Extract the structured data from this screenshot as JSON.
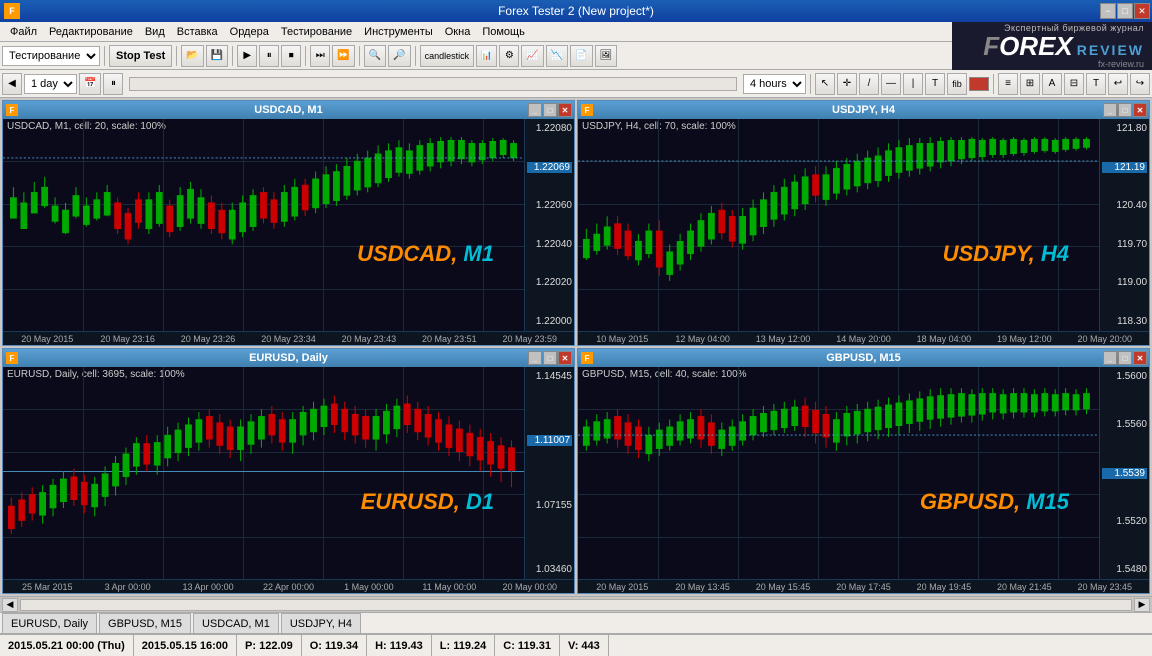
{
  "app": {
    "title": "Forex Tester 2  (New project*)",
    "icon": "FT"
  },
  "titlebar": {
    "minimize": "−",
    "maximize": "□",
    "close": "✕"
  },
  "menubar": {
    "items": [
      "Файл",
      "Редактирование",
      "Вид",
      "Вставка",
      "Ордера",
      "Тестирование",
      "Инструменты",
      "Окна",
      "Помощь"
    ]
  },
  "toolbar1": {
    "testing_label": "Тестирование",
    "stop_test": "Stop Test",
    "timeframe": "1 day"
  },
  "toolbar2": {
    "timeframe2": "4 hours"
  },
  "forex_review": {
    "tagline": "Экспертный биржевой журнал",
    "logo1": "FOREX",
    "logo2": "REVIEW",
    "url": "fx-review.ru"
  },
  "charts": [
    {
      "id": "usdcad",
      "title": "USDCAD, M1",
      "info": "USDCAD, M1, cell: 20, scale: 100%",
      "watermark_pair": "USDCAD,",
      "watermark_tf": " M1",
      "prices": [
        "1.22080",
        "1.22069",
        "1.22060",
        "1.22040",
        "1.22020",
        "1.22000"
      ],
      "highlight_price": "1.22069",
      "times": [
        "20 May 2015",
        "20 May 23:16",
        "20 May 23:26",
        "20 May 23:34",
        "20 May 23:43",
        "20 May 23:51",
        "20 May 23:59"
      ],
      "position": "top-left"
    },
    {
      "id": "usdjpy",
      "title": "USDJPY, H4",
      "info": "USDJPY, H4, cell: 70, scale: 100%",
      "watermark_pair": "USDJPY,",
      "watermark_tf": " H4",
      "prices": [
        "121.80",
        "121.19",
        "120.40",
        "119.70",
        "119.00",
        "118.30"
      ],
      "highlight_price": "121.19",
      "times": [
        "10 May 2015",
        "12 May 04:00",
        "13 May 12:00",
        "14 May 20:00",
        "18 May 04:00",
        "19 May 12:00",
        "20 May 20:00"
      ],
      "position": "top-right"
    },
    {
      "id": "eurusd",
      "title": "EURUSD, Daily",
      "info": "EURUSD, Daily, cell: 3695, scale: 100%",
      "watermark_pair": "EURUSD,",
      "watermark_tf": " D1",
      "prices": [
        "1.14545",
        "1.11007",
        "1.07155",
        "1.03460"
      ],
      "highlight_price": "1.11007",
      "times": [
        "25 Mar 2015",
        "3 Apr 00:00",
        "13 Apr 00:00",
        "22 Apr 00:00",
        "1 May 00:00",
        "11 May 00:00",
        "20 May 00:00"
      ],
      "position": "bottom-left"
    },
    {
      "id": "gbpusd",
      "title": "GBPUSD, M15",
      "info": "GBPUSD, M15, cell: 40, scale: 100%",
      "watermark_pair": "GBPUSD,",
      "watermark_tf": " M15",
      "prices": [
        "1.5600",
        "1.5560",
        "1.5539",
        "1.5520",
        "1.5480"
      ],
      "highlight_price": "1.5539",
      "times": [
        "20 May 2015",
        "20 May 13:45",
        "20 May 15:45",
        "20 May 17:45",
        "20 May 19:45",
        "20 May 21:45",
        "20 May 23:45"
      ],
      "position": "bottom-right"
    }
  ],
  "tabs": [
    "EURUSD, Daily",
    "GBPUSD, M15",
    "USDCAD, M1",
    "USDJPY, H4"
  ],
  "statusbar": {
    "datetime": "2015.05.21 00:00 (Thu)",
    "date2": "2015.05.15 16:00",
    "price_p": "P: 122.09",
    "price_o": "O: 119.34",
    "price_h": "H: 119.43",
    "price_l": "L: 119.24",
    "price_c": "C: 119.31",
    "volume": "V: 443"
  }
}
